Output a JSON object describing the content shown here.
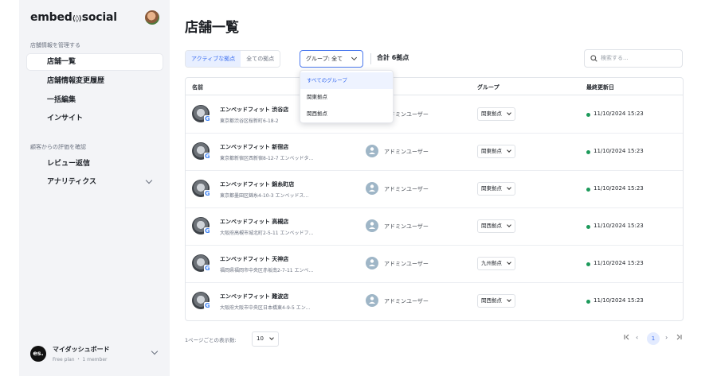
{
  "sidebar": {
    "logo": "embed",
    "logo_mark": "⟨◊⟩",
    "logo_suffix": "social",
    "section1": "店舗情報を管理する",
    "items1": [
      {
        "label": "店舗一覧"
      },
      {
        "label": "店舗情報変更履歴"
      },
      {
        "label": "一括編集"
      },
      {
        "label": "インサイト"
      }
    ],
    "section2": "顧客からの評価を確認",
    "items2": [
      {
        "label": "レビュー返信"
      },
      {
        "label": "アナリティクス"
      }
    ],
    "account": {
      "logo": "es.",
      "name": "マイダッシュボード",
      "plan": "Free plan ・ 1 member"
    }
  },
  "main": {
    "title": "店舗一覧",
    "tabs": [
      {
        "label": "アクティブな拠点"
      },
      {
        "label": "全ての拠点"
      }
    ],
    "group_select": "グループ: 全て",
    "total": "合計 6拠点",
    "search_placeholder": "検索する...",
    "columns": {
      "name": "名前",
      "group": "グループ",
      "updated": "最終更新日"
    },
    "dropdown": [
      "すべてのグループ",
      "関東拠点",
      "関西拠点"
    ],
    "rows": [
      {
        "name": "エンベッドフィット 渋谷店",
        "address": "東京都渋谷区桜新町6-18-2",
        "user": "アドミンユーザー",
        "group": "関東拠点",
        "updated": "11/10/2024 15:23"
      },
      {
        "name": "エンベッドフィット 新宿店",
        "address": "東京都新宿区西新宿8-12-7 エンベッドタ...",
        "user": "アドミンユーザー",
        "group": "関東拠点",
        "updated": "11/10/2024 15:23"
      },
      {
        "name": "エンベッドフィット 錦糸町店",
        "address": "東京都墨田区錦糸4-10-3 エンベッドス...",
        "user": "アドミンユーザー",
        "group": "関東拠点",
        "updated": "11/10/2024 15:23"
      },
      {
        "name": "エンベッドフィット 高槻店",
        "address": "大阪府高槻市城北町2-5-11 エンベッドフ...",
        "user": "アドミンユーザー",
        "group": "関西拠点",
        "updated": "11/10/2024 15:23"
      },
      {
        "name": "エンベッドフィット 天神店",
        "address": "福岡県福岡市中央区赤坂南2-7-11 エンベ...",
        "user": "アドミンユーザー",
        "group": "九州拠点",
        "updated": "11/10/2024 15:23"
      },
      {
        "name": "エンベッドフィット 難波店",
        "address": "大阪府大阪市中央区日本橋東4-9-5 エン...",
        "user": "アドミンユーザー",
        "group": "関西拠点",
        "updated": "11/10/2024 15:23"
      }
    ],
    "per_page_label": "1ページごとの表示数:",
    "per_page": "10",
    "pager": {
      "first": "ⅠＫ",
      "prev": "‹",
      "current": "1",
      "next": "›",
      "last": "›Ⅰ"
    }
  },
  "colors": {
    "accent": "#3a6df0",
    "status": "#1d9a5b",
    "sidebar_bg": "#f3f4f7"
  }
}
